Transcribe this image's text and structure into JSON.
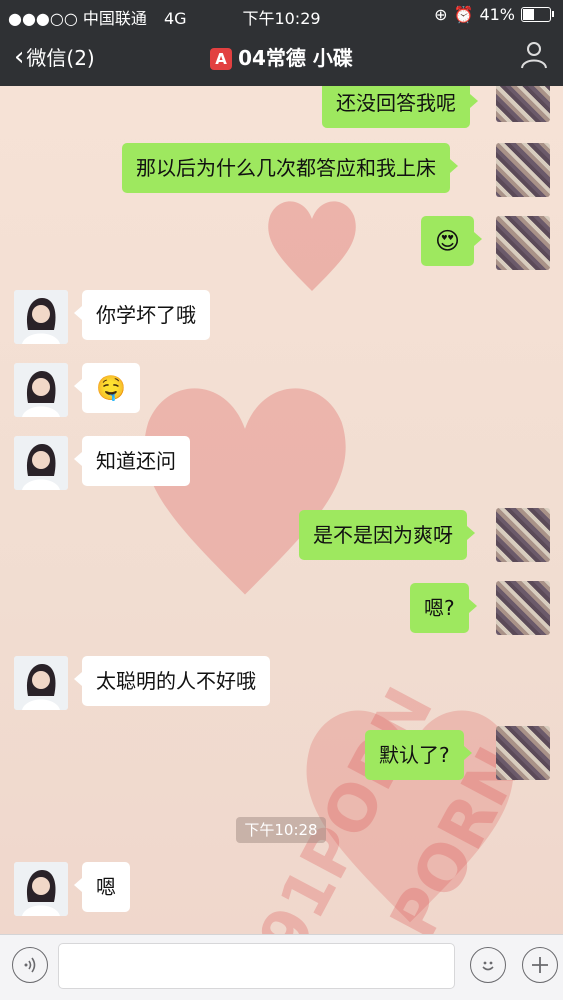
{
  "status_bar": {
    "carrier": "●●●○○ 中国联通",
    "network": "4G",
    "time": "下午10:29",
    "battery": "41%",
    "battery_level": 0.41
  },
  "nav": {
    "back_label": "微信(2)",
    "title_badge": "A",
    "title": "04常德 小碟"
  },
  "messages": [
    {
      "side": "sent",
      "text": "还没回答我呢"
    },
    {
      "side": "sent",
      "text": "那以后为什么几次都答应和我上床"
    },
    {
      "side": "sent",
      "emoji": "😍"
    },
    {
      "side": "recv",
      "text": "你学坏了哦"
    },
    {
      "side": "recv",
      "emoji": "🤤"
    },
    {
      "side": "recv",
      "text": "知道还问"
    },
    {
      "side": "sent",
      "text": "是不是因为爽呀"
    },
    {
      "side": "sent",
      "text": "嗯?"
    },
    {
      "side": "recv",
      "text": "太聪明的人不好哦"
    },
    {
      "side": "sent",
      "text": "默认了?"
    },
    {
      "side": "recv",
      "text": "嗯"
    }
  ],
  "timestamp": "下午10:28",
  "watermark": "91PORN",
  "colors": {
    "nav_bg": "#2f3134",
    "sent_bubble": "#9ee85f",
    "recv_bubble": "#ffffff",
    "heart": "#e8a39b"
  },
  "input": {
    "voice_icon": "voice-icon",
    "emoji_icon": "emoji-icon",
    "plus_icon": "plus-icon"
  }
}
